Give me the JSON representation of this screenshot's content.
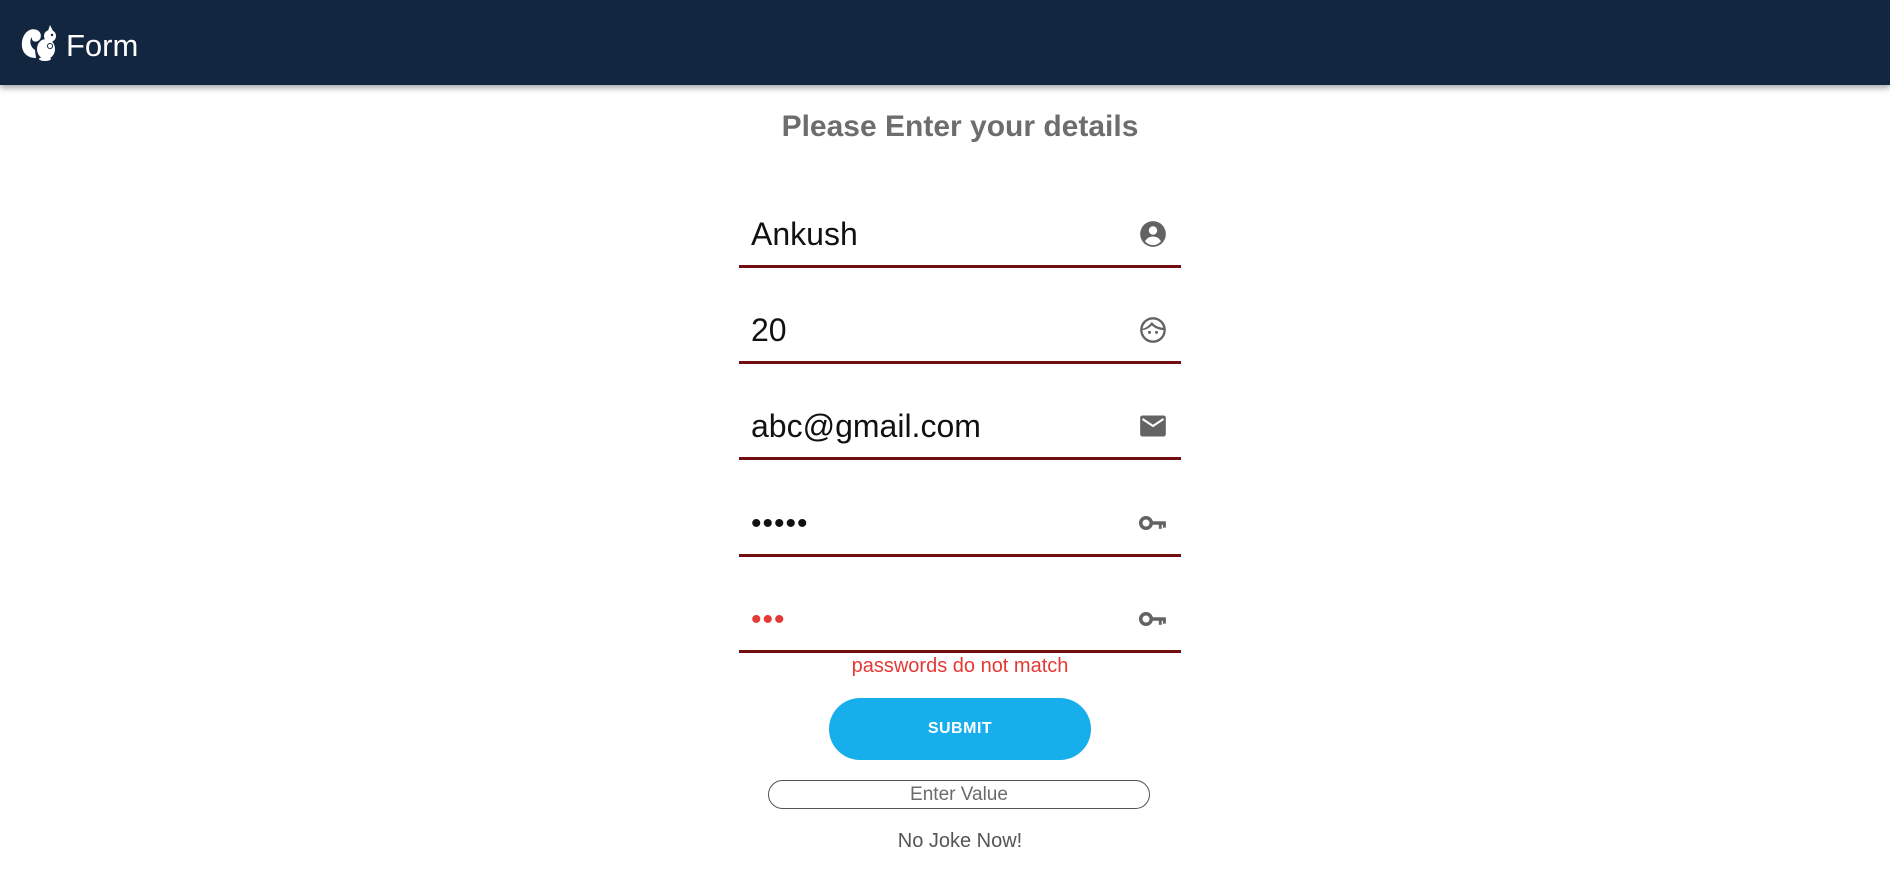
{
  "header": {
    "title": "Form",
    "logo_icon": "squirrel-icon",
    "background": "#13263f"
  },
  "page": {
    "title": "Please Enter your details"
  },
  "form": {
    "fields": [
      {
        "name": "name",
        "value": "Ankush",
        "icon": "account-circle-icon"
      },
      {
        "name": "age",
        "value": "20",
        "icon": "face-icon"
      },
      {
        "name": "email",
        "value": "abc@gmail.com",
        "icon": "mail-icon"
      },
      {
        "name": "password",
        "masked_value": "•••••",
        "icon": "key-icon"
      },
      {
        "name": "confirm-password",
        "masked_value": "•••",
        "icon": "key-icon"
      }
    ],
    "error_message": "passwords do not match",
    "error_color": "#e53935",
    "underline_color": "#6e0e0e",
    "submit_label": "SUBMIT",
    "submit_color": "#16aeeb"
  },
  "extra": {
    "value_placeholder": "Enter Value",
    "joke_text": "No Joke Now!"
  }
}
